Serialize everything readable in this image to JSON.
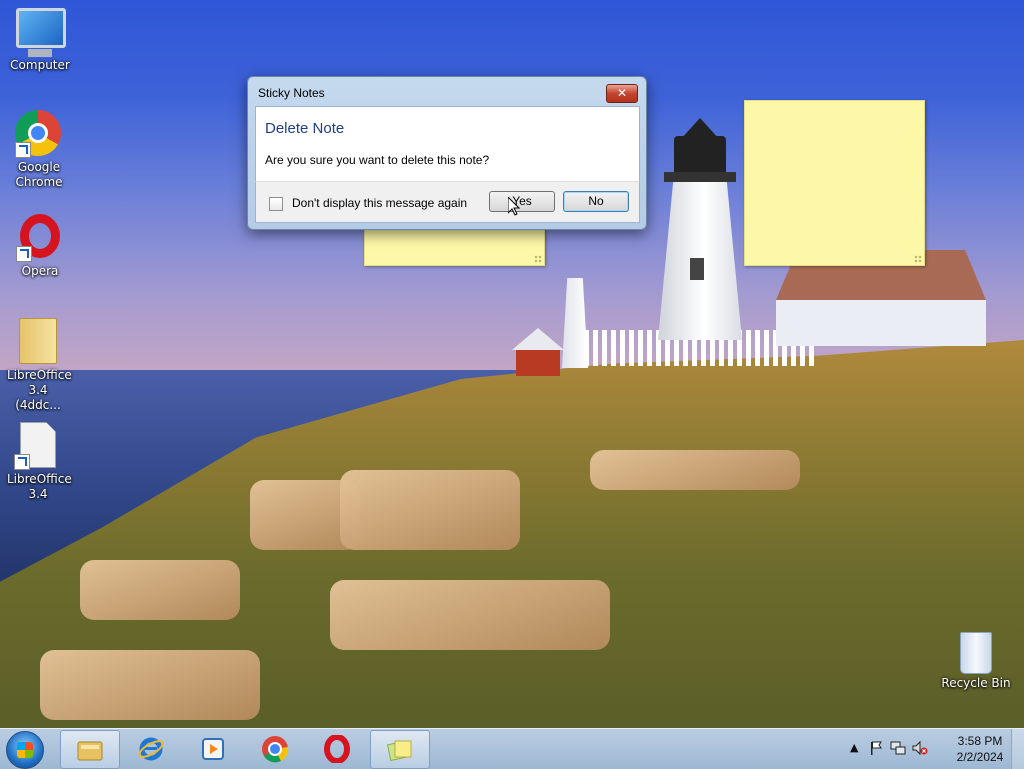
{
  "desktop": {
    "icons": [
      {
        "label": "Computer"
      },
      {
        "label": "Google Chrome"
      },
      {
        "label": "Opera"
      },
      {
        "label": "LibreOffice 3.4 (4ddc..."
      },
      {
        "label": "LibreOffice 3.4"
      },
      {
        "label": "Recycle Bin"
      }
    ]
  },
  "dialog": {
    "title": "Sticky Notes",
    "close_symbol": "✕",
    "heading": "Delete Note",
    "message": "Are you sure you want to delete this note?",
    "checkbox_label": "Don't display this message again",
    "checkbox_checked": false,
    "yes_label": "Yes",
    "no_label": "No"
  },
  "taskbar": {
    "pinned": [
      "windows-explorer",
      "internet-explorer",
      "windows-media-player",
      "google-chrome",
      "opera",
      "sticky-notes"
    ],
    "tray_arrow": "▲",
    "clock_time": "3:58 PM",
    "clock_date": "2/2/2024"
  }
}
